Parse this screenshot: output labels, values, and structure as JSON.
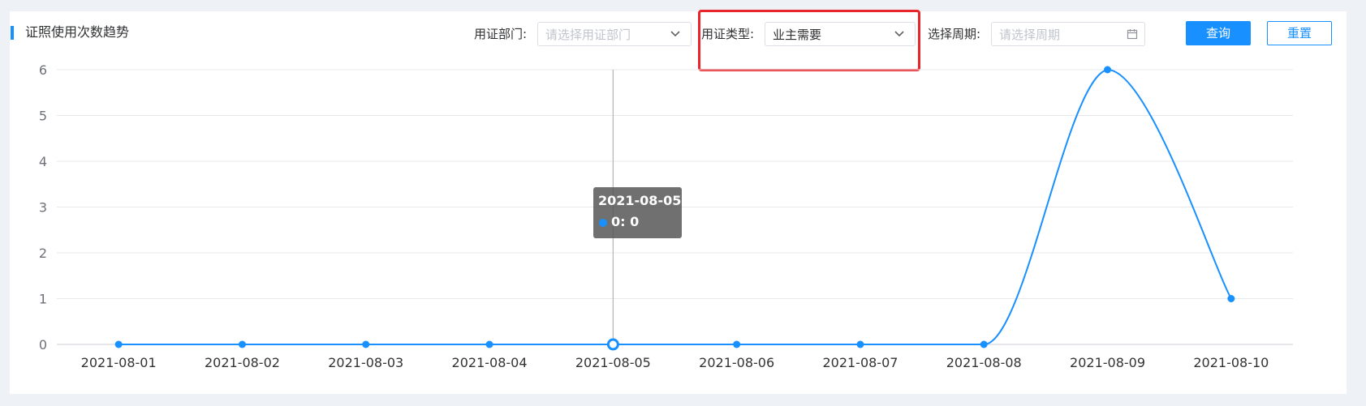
{
  "header": {
    "title": "证照使用次数趋势"
  },
  "filters": {
    "dept_label": "用证部门:",
    "dept_placeholder": "请选择用证部门",
    "type_label": "用证类型:",
    "type_value": "业主需要",
    "period_label": "选择周期:",
    "period_placeholder": "请选择周期",
    "query_button": "查询",
    "reset_button": "重置"
  },
  "colors": {
    "accent": "#1890ff",
    "highlight": "#e8252a"
  },
  "tooltip": {
    "date": "2021-08-05",
    "value_text": "0: 0"
  },
  "chart_data": {
    "type": "line",
    "smooth": true,
    "categories": [
      "2021-08-01",
      "2021-08-02",
      "2021-08-03",
      "2021-08-04",
      "2021-08-05",
      "2021-08-06",
      "2021-08-07",
      "2021-08-08",
      "2021-08-09",
      "2021-08-10"
    ],
    "series": [
      {
        "values": [
          0,
          0,
          0,
          0,
          0,
          0,
          0,
          0,
          6,
          1
        ]
      }
    ],
    "y_ticks": [
      "0",
      "1",
      "2",
      "3",
      "4",
      "5",
      "6"
    ],
    "ylim": [
      0,
      6
    ],
    "grid": true,
    "hovered_index": 4
  }
}
